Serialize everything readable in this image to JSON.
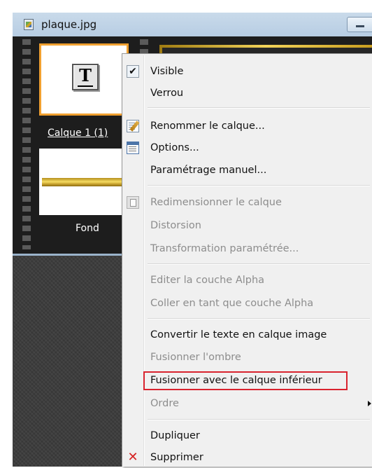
{
  "window": {
    "title": "plaque.jpg"
  },
  "layers": [
    {
      "label": "Calque 1 (1)",
      "type": "text",
      "icon_glyph": "T",
      "selected": true
    },
    {
      "label": "Fond",
      "type": "image",
      "selected": false
    }
  ],
  "menu": {
    "visible": "Visible",
    "lock": "Verrou",
    "rename": "Renommer le calque...",
    "options": "Options...",
    "manual_settings": "Paramétrage manuel...",
    "resize": "Redimensionner le calque",
    "distortion": "Distorsion",
    "param_transform": "Transformation paramétrée...",
    "edit_alpha": "Editer la couche Alpha",
    "paste_alpha": "Coller en tant que couche Alpha",
    "convert_text": "Convertir le texte en calque image",
    "merge_shadow": "Fusionner l'ombre",
    "merge_down": "Fusionner avec le calque inférieur",
    "order": "Ordre",
    "duplicate": "Dupliquer",
    "delete": "Supprimer"
  },
  "icons": {
    "check": "✔",
    "delete": "✕"
  },
  "colors": {
    "highlight_outline": "#d9232e",
    "selected_layer_border": "#f0a030",
    "delete_icon": "#d62020"
  }
}
